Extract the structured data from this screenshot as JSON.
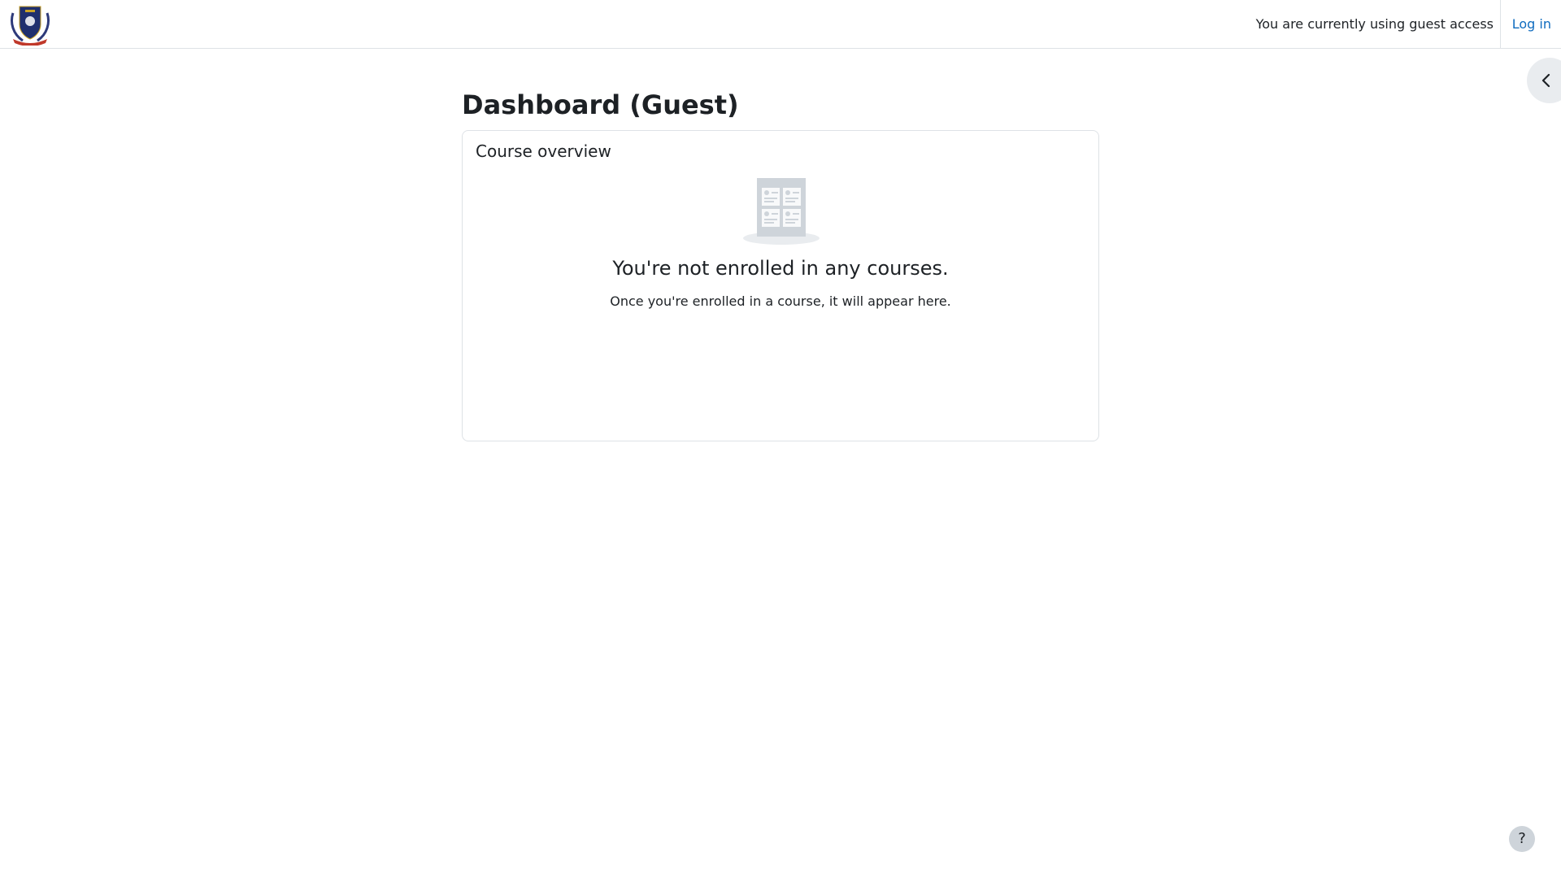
{
  "header": {
    "logo_icon": "school-crest-logo",
    "guest_notice": "You are currently using guest access",
    "login_label": "Log in",
    "login_color": "#0f6cbf"
  },
  "drawer": {
    "toggle_icon": "chevron-left-icon"
  },
  "main": {
    "page_title": "Dashboard (Guest)",
    "course_overview": {
      "block_title": "Course overview",
      "empty_icon": "courses-grid-icon",
      "empty_heading": "You're not enrolled in any courses.",
      "empty_message": "Once you're enrolled in a course, it will appear here."
    }
  },
  "footer": {
    "help_label": "?",
    "help_icon": "question-mark-icon"
  }
}
